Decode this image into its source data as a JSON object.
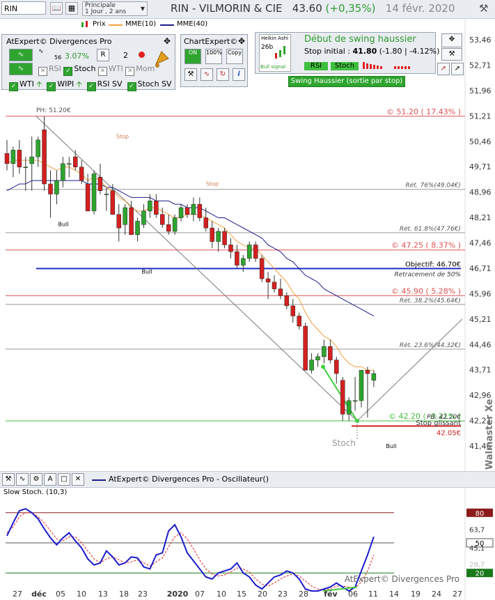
{
  "toolbar": {
    "symbol": "RIN",
    "period_title": "Principale",
    "period_value": "1 Jour , 2 ans",
    "title": "RIN - VILMORIN & CIE",
    "price": "43.60",
    "change": "(+0,35%)",
    "date": "14 févr. 2020"
  },
  "legend": {
    "prix": "Prix",
    "mme10": "MME(10)",
    "mme40": "MME(40)"
  },
  "atexpert_panel": {
    "title": "AtExpert© Divergences Pro",
    "pct": "3.07%",
    "count": "2",
    "small_num": "56",
    "checks": [
      {
        "label": "RSI",
        "on": false
      },
      {
        "label": "Stoch",
        "on": true
      },
      {
        "label": "WTI",
        "on": false
      },
      {
        "label": "Mom",
        "on": false
      }
    ],
    "row2": [
      {
        "label": "WTI",
        "on": true
      },
      {
        "label": "WIPI",
        "on": true
      },
      {
        "label": "RSI SV",
        "on": true
      },
      {
        "label": "Stoch SV",
        "on": true
      }
    ]
  },
  "chartexpert_panel": {
    "title": "ChartExpert©",
    "btn_on": "ON",
    "btn_100": "100%",
    "btn_copy": "Copy"
  },
  "signal_panel": {
    "heikin": "Heikin Ashi",
    "days": "26b",
    "bull_signal": "Bull signal",
    "title": "Début de swing haussier",
    "stop_label": "Stop initial :",
    "stop_value": "41.80",
    "stop_change": "(-1.80 | -4.12%)",
    "rsi": "RSI",
    "stoch": "Stoch",
    "swing": "Swing Haussier (sortie par stop)"
  },
  "colors": {
    "up": "#2ea52e",
    "down": "#d42020",
    "mme10": "#f0a040",
    "mme40": "#1c1c8c",
    "red_level": "#e05050",
    "blue_level": "#1f2fc8",
    "green_level": "#3fbf3f"
  },
  "annotations": {
    "ph": "PH: 51.20€",
    "pb": "PB: 42.20€",
    "level_5120": "© 51.20 ( 17.43% )",
    "level_4725": "© 47.25 ( 8.37% )",
    "level_4590": "© 45.90 ( 5.28% )",
    "level_4220": "© 42.20 ( -3.21% )",
    "ret76": "Rét. 76%(49.04€)",
    "ret618": "Rét. 61.8%(47.76€)",
    "ret50": "Retracement de 50%",
    "ret382": "Rét. 38.2%(45.64€)",
    "ret236": "Rét. 23.6%(44.32€)",
    "objectif": "Objectif: 46.70€",
    "stop_glissant": "Stop glissant",
    "stop_value": "42.05€",
    "stoch": "Stoch",
    "stop": "Stop",
    "bull": "Bull",
    "watermark": "Walmaster Xe"
  },
  "osc": {
    "title": "AtExpert© Divergences Pro - Oscillateur()",
    "label": "Slow Stoch. (10,3)",
    "watermark": "AtExpert© Divergences Pro",
    "level_80": "80",
    "level_50": "50",
    "level_20": "20",
    "tick_637": "63,7",
    "tick_451": "45,1",
    "tick_287": "28,7"
  },
  "chart_data": {
    "type": "candlestick",
    "y_ticks": [
      "53,46",
      "52,71",
      "51,96",
      "51,21",
      "50,46",
      "49,71",
      "48,96",
      "48,21",
      "47,46",
      "46,71",
      "45,96",
      "45,21",
      "44,46",
      "43,71",
      "42,96",
      "42,21",
      "41,46"
    ],
    "x_ticks": [
      "27",
      "déc",
      "05",
      "10",
      "13",
      "18",
      "23",
      "2020",
      "07",
      "10",
      "15",
      "20",
      "23",
      "28",
      "fév",
      "06",
      "11",
      "14",
      "19",
      "24",
      "27"
    ],
    "ylim": [
      41.0,
      53.8
    ],
    "candles": [
      [
        50.1,
        50.5,
        49.6,
        49.8
      ],
      [
        49.8,
        50.3,
        49.4,
        50.2
      ],
      [
        50.2,
        50.5,
        49.5,
        49.7
      ],
      [
        49.7,
        50.0,
        49.0,
        49.7
      ],
      [
        49.8,
        50.6,
        49.0,
        50.0
      ],
      [
        50.0,
        50.6,
        49.7,
        50.5
      ],
      [
        50.8,
        51.2,
        49.0,
        49.2
      ],
      [
        49.2,
        49.6,
        48.2,
        48.9
      ],
      [
        48.9,
        49.6,
        48.6,
        49.3
      ],
      [
        49.3,
        50.0,
        49.1,
        49.8
      ],
      [
        49.8,
        50.0,
        49.4,
        49.8
      ],
      [
        50.0,
        50.2,
        49.6,
        49.7
      ],
      [
        49.7,
        49.9,
        49.2,
        49.3
      ],
      [
        49.2,
        49.5,
        48.4,
        48.4
      ],
      [
        48.4,
        49.6,
        48.3,
        49.5
      ],
      [
        49.4,
        49.8,
        48.9,
        49.0
      ],
      [
        48.9,
        49.1,
        48.4,
        48.9
      ],
      [
        49.0,
        49.2,
        48.3,
        48.3
      ],
      [
        48.3,
        48.6,
        47.5,
        47.9
      ],
      [
        48.0,
        48.6,
        47.7,
        48.5
      ],
      [
        48.5,
        48.7,
        47.7,
        47.7
      ],
      [
        47.7,
        48.2,
        47.5,
        48.1
      ],
      [
        48.0,
        48.6,
        47.9,
        48.4
      ],
      [
        48.4,
        48.9,
        48.2,
        48.7
      ],
      [
        48.7,
        48.9,
        48.2,
        48.3
      ],
      [
        48.3,
        48.5,
        47.9,
        48.0
      ],
      [
        48.0,
        48.3,
        47.7,
        47.8
      ],
      [
        47.8,
        48.3,
        47.7,
        48.2
      ],
      [
        48.2,
        48.6,
        48.1,
        48.5
      ],
      [
        48.5,
        48.6,
        48.2,
        48.3
      ],
      [
        48.3,
        48.8,
        48.1,
        48.6
      ],
      [
        48.6,
        48.8,
        48.1,
        48.2
      ],
      [
        48.2,
        48.5,
        47.8,
        47.9
      ],
      [
        47.9,
        48.1,
        47.3,
        47.5
      ],
      [
        47.5,
        47.9,
        47.2,
        47.8
      ],
      [
        47.8,
        47.9,
        47.3,
        47.4
      ],
      [
        47.4,
        47.6,
        47.0,
        47.2
      ],
      [
        47.2,
        47.4,
        46.7,
        46.8
      ],
      [
        46.8,
        47.1,
        46.6,
        47.0
      ],
      [
        47.0,
        47.5,
        46.9,
        47.4
      ],
      [
        47.4,
        47.5,
        46.9,
        47.0
      ],
      [
        47.0,
        47.1,
        46.3,
        46.4
      ],
      [
        46.4,
        46.6,
        45.8,
        46.3
      ],
      [
        46.3,
        46.5,
        46.0,
        46.1
      ],
      [
        46.1,
        46.4,
        45.8,
        45.9
      ],
      [
        45.9,
        46.0,
        45.5,
        45.6
      ],
      [
        45.6,
        45.8,
        45.1,
        45.3
      ],
      [
        45.3,
        45.4,
        44.9,
        45.0
      ],
      [
        45.0,
        45.1,
        43.7,
        43.7
      ],
      [
        43.7,
        44.2,
        43.6,
        44.0
      ],
      [
        44.0,
        44.2,
        43.8,
        44.1
      ],
      [
        44.1,
        44.6,
        43.9,
        44.4
      ],
      [
        44.4,
        44.6,
        43.9,
        44.0
      ],
      [
        44.0,
        44.1,
        43.3,
        43.6
      ],
      [
        43.4,
        43.5,
        42.2,
        42.4
      ],
      [
        42.4,
        42.9,
        42.2,
        42.8
      ],
      [
        42.8,
        43.5,
        42.5,
        42.8
      ],
      [
        42.8,
        43.7,
        42.6,
        43.7
      ],
      [
        43.7,
        43.8,
        42.3,
        43.6
      ],
      [
        43.4,
        43.7,
        43.2,
        43.6
      ]
    ],
    "series": [
      {
        "name": "MME(10)",
        "values": [
          49.8,
          49.9,
          49.9,
          49.9,
          49.9,
          49.9,
          49.8,
          49.7,
          49.6,
          49.7,
          49.7,
          49.6,
          49.5,
          49.3,
          49.4,
          49.3,
          49.1,
          49.0,
          48.8,
          48.7,
          48.5,
          48.4,
          48.4,
          48.5,
          48.5,
          48.4,
          48.3,
          48.2,
          48.2,
          48.3,
          48.3,
          48.3,
          48.2,
          48.1,
          48.0,
          47.9,
          47.7,
          47.5,
          47.4,
          47.3,
          47.3,
          47.1,
          46.9,
          46.7,
          46.5,
          46.3,
          46.0,
          45.8,
          45.4,
          45.1,
          44.9,
          44.7,
          44.6,
          44.4,
          44.1,
          43.9,
          43.8,
          43.8,
          43.7,
          43.7
        ]
      },
      {
        "name": "MME(40)",
        "values": [
          49.0,
          49.1,
          49.2,
          49.2,
          49.3,
          49.3,
          49.3,
          49.3,
          49.3,
          49.3,
          49.3,
          49.3,
          49.3,
          49.2,
          49.2,
          49.2,
          49.1,
          49.1,
          49.0,
          48.9,
          48.8,
          48.8,
          48.8,
          48.8,
          48.7,
          48.7,
          48.7,
          48.6,
          48.6,
          48.5,
          48.5,
          48.5,
          48.4,
          48.3,
          48.2,
          48.2,
          48.1,
          48.0,
          47.9,
          47.8,
          47.7,
          47.6,
          47.4,
          47.3,
          47.2,
          47.0,
          46.9,
          46.7,
          46.5,
          46.4,
          46.3,
          46.1,
          46.0,
          45.9,
          45.8,
          45.7,
          45.6,
          45.5,
          45.4,
          45.3
        ]
      }
    ],
    "stoch": {
      "k": [
        57,
        70,
        82,
        84,
        80,
        74,
        64,
        55,
        48,
        55,
        60,
        52,
        45,
        34,
        28,
        30,
        42,
        36,
        28,
        30,
        36,
        35,
        26,
        24,
        38,
        40,
        62,
        68,
        56,
        40,
        32,
        24,
        16,
        14,
        20,
        22,
        24,
        30,
        20,
        16,
        8,
        4,
        10,
        16,
        18,
        22,
        20,
        14,
        4,
        2,
        2,
        4,
        6,
        10,
        6,
        2,
        6,
        22,
        38,
        56
      ],
      "d": [
        60,
        66,
        76,
        80,
        80,
        76,
        70,
        62,
        54,
        52,
        56,
        56,
        50,
        42,
        34,
        30,
        34,
        36,
        33,
        30,
        31,
        33,
        30,
        27,
        31,
        35,
        46,
        56,
        60,
        54,
        44,
        33,
        24,
        19,
        17,
        18,
        21,
        25,
        24,
        21,
        14,
        9,
        7,
        10,
        14,
        17,
        19,
        17,
        12,
        7,
        4,
        3,
        4,
        7,
        7,
        6,
        5,
        11,
        22,
        38
      ]
    }
  }
}
